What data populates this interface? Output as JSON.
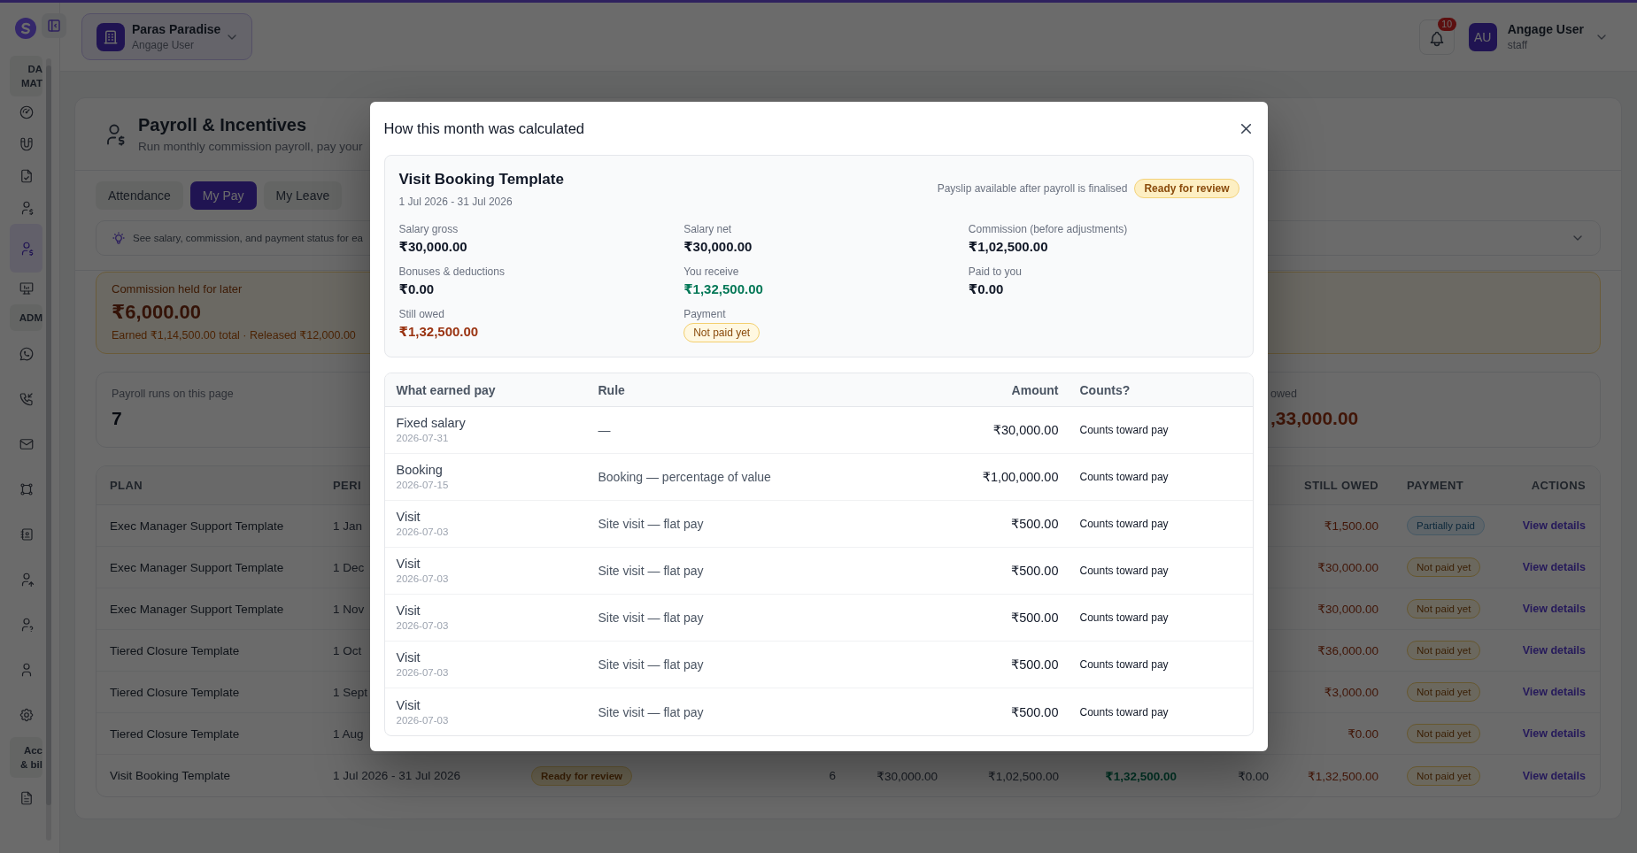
{
  "app_header": {
    "org": {
      "name": "Paras Paradise",
      "subtitle": "Angage User"
    },
    "notifications": {
      "count": "10"
    },
    "user": {
      "initials": "AU",
      "name": "Angage User",
      "role": "staff"
    }
  },
  "sidebar": {
    "items": [
      {
        "kind": "group",
        "label": "DA\nMAT"
      },
      {
        "kind": "link",
        "selected": false
      },
      {
        "kind": "link",
        "selected": false
      },
      {
        "kind": "link",
        "selected": false
      },
      {
        "kind": "link",
        "selected": false
      },
      {
        "kind": "link",
        "selected": true
      },
      {
        "kind": "link",
        "selected": false
      },
      {
        "kind": "group",
        "label": "ADM"
      },
      {
        "kind": "link",
        "selected": false
      },
      {
        "kind": "link",
        "selected": false
      },
      {
        "kind": "link",
        "selected": false
      },
      {
        "kind": "link",
        "selected": false
      },
      {
        "kind": "link",
        "selected": false
      },
      {
        "kind": "link",
        "selected": false
      },
      {
        "kind": "link",
        "selected": false
      },
      {
        "kind": "link",
        "selected": false
      },
      {
        "kind": "link",
        "selected": false
      },
      {
        "kind": "group",
        "label": "Acc\n& bil"
      },
      {
        "kind": "link",
        "selected": false
      }
    ]
  },
  "page": {
    "title": "Payroll & Incentives",
    "subtitle": "Run monthly commission payroll, pay your"
  },
  "tabs": [
    {
      "label": "Attendance",
      "selected": false
    },
    {
      "label": "My Pay",
      "selected": true
    },
    {
      "label": "My Leave",
      "selected": false
    }
  ],
  "info_banner": {
    "text": "See salary, commission, and payment status for ea"
  },
  "commission_card": {
    "title": "Commission held for later",
    "amount": "₹6,000.00",
    "note": "Earned ₹1,14,500.00 total · Released ₹12,000.00"
  },
  "stats": [
    {
      "kind": "count",
      "label": "Payroll runs on this page",
      "value": "7"
    },
    {
      "kind": "owed",
      "label": "owed",
      "value": ",33,000.00"
    }
  ],
  "payroll_table": {
    "columns": {
      "plan": "PLAN",
      "column_2": "PERI",
      "still_owed": "STILL OWED",
      "payment": "PAYMENT",
      "actions": "ACTIONS"
    },
    "rows": [
      {
        "plan": "Exec Manager Support Template",
        "column_2": "1 Jan",
        "still_owed": "₹1,500.00",
        "payment": {
          "label": "Partially paid",
          "kind": "partial"
        },
        "actions": "View details"
      },
      {
        "plan": "Exec Manager Support Template",
        "column_2": "1 Dec",
        "still_owed": "₹30,000.00",
        "payment": {
          "label": "Not paid yet",
          "kind": "unpaid"
        },
        "actions": "View details"
      },
      {
        "plan": "Exec Manager Support Template",
        "column_2": "1 Nov",
        "still_owed": "₹30,000.00",
        "payment": {
          "label": "Not paid yet",
          "kind": "unpaid"
        },
        "actions": "View details"
      },
      {
        "plan": "Tiered Closure Template",
        "column_2": "1 Oct",
        "still_owed": "₹36,000.00",
        "payment": {
          "label": "Not paid yet",
          "kind": "unpaid"
        },
        "actions": "View details"
      },
      {
        "plan": "Tiered Closure Template",
        "column_2": "1 Sept",
        "still_owed": "₹3,000.00",
        "payment": {
          "label": "Not paid yet",
          "kind": "unpaid"
        },
        "actions": "View details"
      },
      {
        "plan": "Tiered Closure Template",
        "column_2": "1 Aug",
        "still_owed": "₹0.00",
        "payment": {
          "label": "Not paid yet",
          "kind": "unpaid"
        },
        "actions": "View details"
      },
      {
        "plan": "Visit Booking Template",
        "column_2": "1 Jul 2026 - 31 Jul 2026",
        "column_3": {
          "label": "Ready for review",
          "kind": "review"
        },
        "column_4": "6",
        "column_5": "₹30,000.00",
        "column_6": "₹1,02,500.00",
        "column_7": "₹1,32,500.00",
        "column_8": "₹0.00",
        "still_owed": "₹1,32,500.00",
        "payment": {
          "label": "Not paid yet",
          "kind": "unpaid"
        },
        "actions": "View details"
      }
    ]
  },
  "modal": {
    "title": "How this month was calculated",
    "summary": {
      "plan": "Visit Booking Template",
      "period": "1 Jul 2026 - 31 Jul 2026",
      "note": "Payslip available after payroll is finalised",
      "status": {
        "label": "Ready for review",
        "kind": "review"
      },
      "fields": [
        {
          "kind": "plain",
          "label": "Salary gross",
          "value": "₹30,000.00"
        },
        {
          "kind": "plain",
          "label": "Salary net",
          "value": "₹30,000.00"
        },
        {
          "kind": "plain",
          "label": "Commission (before adjustments)",
          "value": "₹1,02,500.00"
        },
        {
          "kind": "plain",
          "label": "Bonuses & deductions",
          "value": "₹0.00"
        },
        {
          "kind": "positive",
          "label": "You receive",
          "value": "₹1,32,500.00"
        },
        {
          "kind": "plain",
          "label": "Paid to you",
          "value": "₹0.00"
        },
        {
          "kind": "owed",
          "label": "Still owed",
          "value": "₹1,32,500.00"
        },
        {
          "kind": "badge",
          "label": "Payment",
          "badge": {
            "label": "Not paid yet",
            "kind": "unpaid"
          }
        }
      ]
    },
    "breakdown": {
      "columns": [
        "What earned pay",
        "Rule",
        "Amount",
        "Counts?"
      ],
      "rows": [
        {
          "item": "Fixed salary",
          "date": "2026-07-31",
          "rule": "—",
          "amount": "₹30,000.00",
          "counts": "Counts toward pay"
        },
        {
          "item": "Booking",
          "date": "2026-07-15",
          "rule": "Booking — percentage of value",
          "amount": "₹1,00,000.00",
          "counts": "Counts toward pay"
        },
        {
          "item": "Visit",
          "date": "2026-07-03",
          "rule": "Site visit — flat pay",
          "amount": "₹500.00",
          "counts": "Counts toward pay"
        },
        {
          "item": "Visit",
          "date": "2026-07-03",
          "rule": "Site visit — flat pay",
          "amount": "₹500.00",
          "counts": "Counts toward pay"
        },
        {
          "item": "Visit",
          "date": "2026-07-03",
          "rule": "Site visit — flat pay",
          "amount": "₹500.00",
          "counts": "Counts toward pay"
        },
        {
          "item": "Visit",
          "date": "2026-07-03",
          "rule": "Site visit — flat pay",
          "amount": "₹500.00",
          "counts": "Counts toward pay"
        },
        {
          "item": "Visit",
          "date": "2026-07-03",
          "rule": "Site visit — flat pay",
          "amount": "₹500.00",
          "counts": "Counts toward pay"
        }
      ]
    }
  }
}
